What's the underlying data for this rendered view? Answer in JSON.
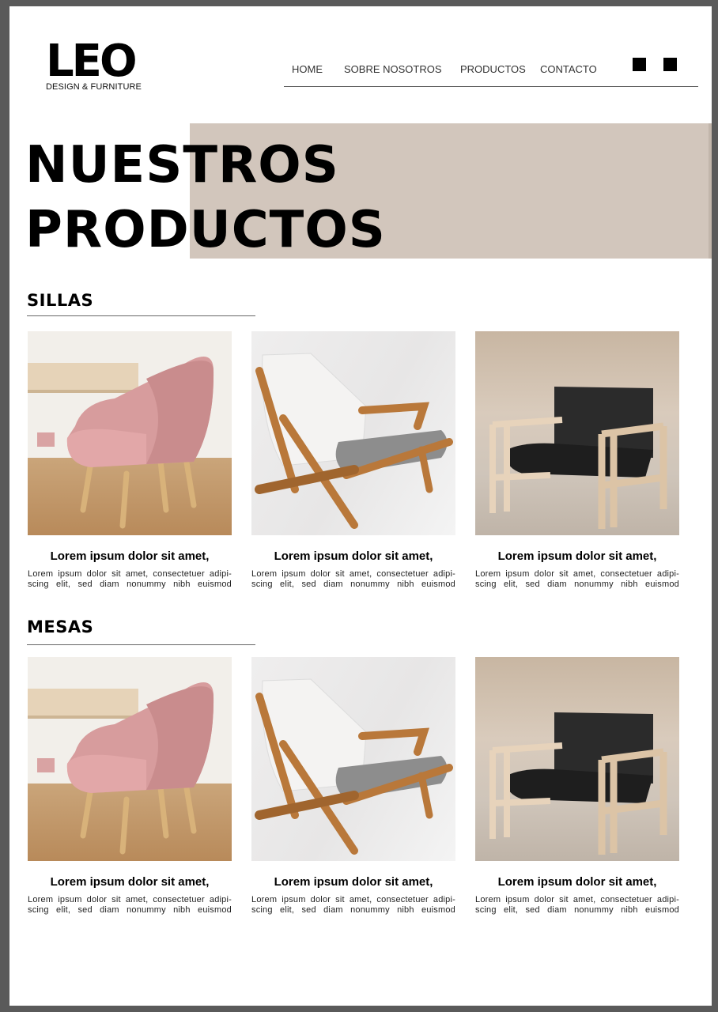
{
  "brand": {
    "name": "LEO",
    "tagline": "DESIGN & FURNITURE"
  },
  "nav": {
    "items": [
      {
        "label": "HOME"
      },
      {
        "label": "SOBRE NOSOTROS"
      },
      {
        "label": "PRODUCTOS"
      },
      {
        "label": "CONTACTO"
      }
    ]
  },
  "hero": {
    "line1": "NUESTROS",
    "line2": "PRODUCTOS"
  },
  "colors": {
    "accent_band": "#d2c6bc",
    "text": "#000000"
  },
  "sections": [
    {
      "title": "SILLAS",
      "products": [
        {
          "image": "pink-armchair",
          "title": "Lorem ipsum dolor sit amet,",
          "desc_line1": "Lorem ipsum dolor sit amet, consectetuer adipi-",
          "desc_line2": "scing elit, sed diam nonummy nibh euismod"
        },
        {
          "image": "wooden-lounge-chair",
          "title": "Lorem ipsum dolor sit amet,",
          "desc_line1": "Lorem ipsum dolor sit amet, consectetuer adipi-",
          "desc_line2": "scing elit, sed diam nonummy nibh euismod"
        },
        {
          "image": "black-frame-armchair",
          "title": "Lorem ipsum dolor sit amet,",
          "desc_line1": "Lorem ipsum dolor sit amet, consectetuer adipi-",
          "desc_line2": "scing elit, sed diam nonummy nibh euismod"
        }
      ]
    },
    {
      "title": "MESAS",
      "products": [
        {
          "image": "pink-armchair",
          "title": "Lorem ipsum dolor sit amet,",
          "desc_line1": "Lorem ipsum dolor sit amet, consectetuer adipi-",
          "desc_line2": "scing elit, sed diam nonummy nibh euismod"
        },
        {
          "image": "wooden-lounge-chair",
          "title": "Lorem ipsum dolor sit amet,",
          "desc_line1": "Lorem ipsum dolor sit amet, consectetuer adipi-",
          "desc_line2": "scing elit, sed diam nonummy nibh euismod"
        },
        {
          "image": "black-frame-armchair",
          "title": "Lorem ipsum dolor sit amet,",
          "desc_line1": "Lorem ipsum dolor sit amet, consectetuer adipi-",
          "desc_line2": "scing elit, sed diam nonummy nibh euismod"
        }
      ]
    }
  ]
}
